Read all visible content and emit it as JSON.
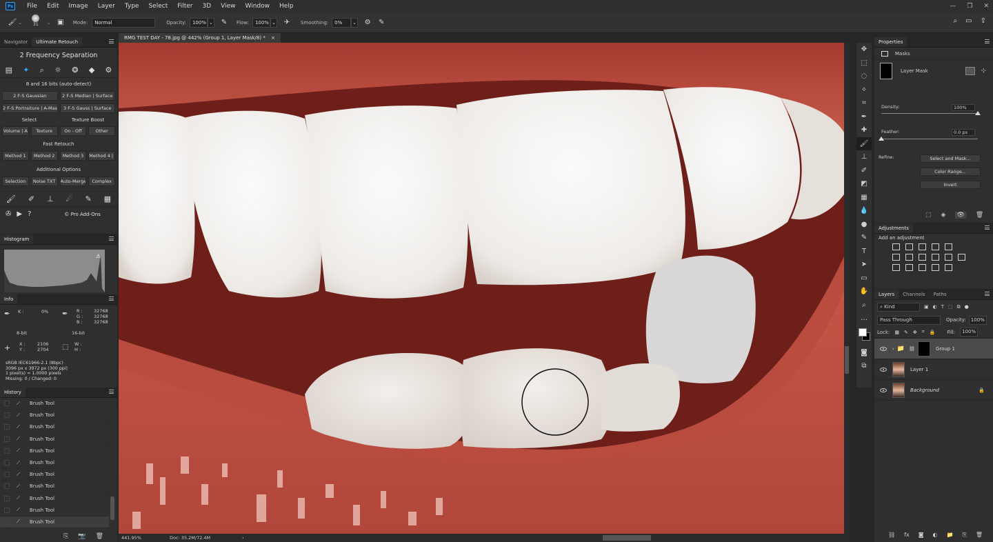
{
  "menubar": {
    "logo": "Ps",
    "items": [
      "File",
      "Edit",
      "Image",
      "Layer",
      "Type",
      "Select",
      "Filter",
      "3D",
      "View",
      "Window",
      "Help"
    ]
  },
  "options": {
    "brush_size": "31",
    "mode_label": "Mode:",
    "mode_value": "Normal",
    "opacity_label": "Opacity:",
    "opacity_value": "100%",
    "flow_label": "Flow:",
    "flow_value": "100%",
    "smoothing_label": "Smoothing:",
    "smoothing_value": "0%"
  },
  "document": {
    "tab_title": "RMG TEST DAY - 78.jpg @ 442% (Group 1, Layer Mask/8) *",
    "zoom": "441.95%",
    "doc_info": "Doc: 35.2M/72.4M"
  },
  "left_panel": {
    "tabs": [
      "Navigator",
      "Ultimate Retouch"
    ],
    "title": "2 Frequency Separation",
    "bits_label": "8 and 16 bits (auto-detect)",
    "fs_buttons": [
      "2 F-S Gaussian",
      "2 F-S Median | Surface",
      "2 F-S Portraiture | A-Mask",
      "3 F-S Gauss | Surface"
    ],
    "select_label": "Select",
    "texture_boost_label": "Texture Boost",
    "select_buttons": [
      "Volume | A",
      "Texture",
      "On - Off",
      "Other"
    ],
    "fast_retouch_label": "Fast Retouch",
    "method_buttons": [
      "Method 1",
      "Method 2",
      "Method 3",
      "Method 4 | A"
    ],
    "additional_label": "Additional Options",
    "additional_buttons": [
      "Selection",
      "Noise TXT",
      "Auto-Merge",
      "Complex"
    ],
    "credit": "© Pro Add-Ons"
  },
  "histogram": {
    "tab": "Histogram"
  },
  "info": {
    "tab": "Info",
    "k_label": "K :",
    "k_value": "0%",
    "r_label": "R :",
    "r_value": "32768",
    "g_label": "G :",
    "g_value": "32768",
    "b_label": "B :",
    "b_value": "32768",
    "bit_left": "8-bit",
    "bit_right": "16-bit",
    "x_label": "X :",
    "x_value": "2106",
    "y_label": "Y :",
    "y_value": "2704",
    "w_label": "W :",
    "h_label": "H :",
    "lines": [
      "sRGB IEC61966-2.1 (8bpc)",
      "3096 px x 3972 px (300 ppi)",
      "1 pixel(s) = 1.0000 pixels",
      "Missing: 0 / Changed: 0"
    ]
  },
  "history": {
    "tab": "History",
    "items": [
      "Brush Tool",
      "Brush Tool",
      "Brush Tool",
      "Brush Tool",
      "Brush Tool",
      "Brush Tool",
      "Brush Tool",
      "Brush Tool",
      "Brush Tool",
      "Brush Tool",
      "Brush Tool"
    ]
  },
  "properties": {
    "tab": "Properties",
    "masks_label": "Masks",
    "layer_mask_label": "Layer Mask",
    "density_label": "Density:",
    "density_value": "100%",
    "density_level": 1.0,
    "feather_label": "Feather:",
    "feather_value": "0.0 px",
    "feather_level": 0.0,
    "refine_label": "Refine:",
    "buttons": [
      "Select and Mask...",
      "Color Range...",
      "Invert"
    ]
  },
  "adjustments": {
    "tab": "Adjustments",
    "subtitle": "Add an adjustment"
  },
  "layers": {
    "tabs": [
      "Layers",
      "Channels",
      "Paths"
    ],
    "kind_label": "Kind",
    "blend_mode": "Pass Through",
    "opacity_label": "Opacity:",
    "opacity_value": "100%",
    "lock_label": "Lock:",
    "fill_label": "Fill:",
    "fill_value": "100%",
    "items": [
      {
        "name": "Group 1",
        "type": "group"
      },
      {
        "name": "Layer 1",
        "type": "layer"
      },
      {
        "name": "Background",
        "type": "background"
      }
    ]
  },
  "colors": {
    "accent": "#31a8ff",
    "panel_bg": "#2f2f2f",
    "lip": "#b8473a"
  }
}
